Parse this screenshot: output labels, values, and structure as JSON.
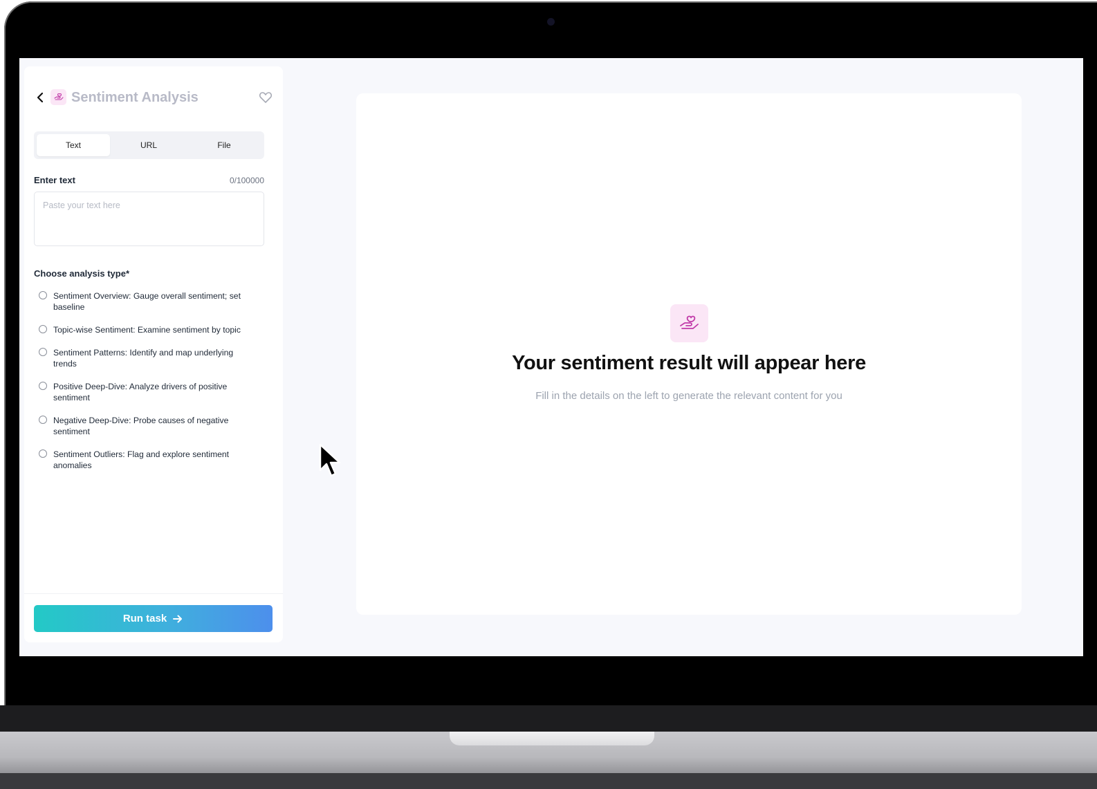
{
  "panel": {
    "title": "Sentiment Analysis",
    "tabs": [
      {
        "label": "Text",
        "active": true
      },
      {
        "label": "URL",
        "active": false
      },
      {
        "label": "File",
        "active": false
      }
    ],
    "input": {
      "label": "Enter text",
      "count": "0/100000",
      "placeholder": "Paste your text here",
      "value": ""
    },
    "analysis": {
      "label": "Choose analysis type*",
      "options": [
        "Sentiment Overview: Gauge overall sentiment; set baseline",
        "Topic-wise Sentiment: Examine sentiment by topic",
        "Sentiment Patterns: Identify and map underlying trends",
        "Positive Deep-Dive: Analyze drivers of positive sentiment",
        "Negative Deep-Dive: Probe causes of negative sentiment",
        "Sentiment Outliers: Flag and explore sentiment anomalies"
      ]
    },
    "run_label": "Run task"
  },
  "result": {
    "title": "Your sentiment result will appear here",
    "subtitle": "Fill in the details on the left to generate the relevant content for you"
  },
  "icons": {
    "back": "chevron-left-icon",
    "app": "hand-heart-icon",
    "favorite": "heart-icon",
    "run": "arrow-right-icon",
    "result": "hand-heart-icon"
  },
  "colors": {
    "accent_start": "#23c9c6",
    "accent_end": "#4d8fec",
    "icon_pink": "#c13aa8",
    "icon_bg": "#fbe6f6"
  }
}
